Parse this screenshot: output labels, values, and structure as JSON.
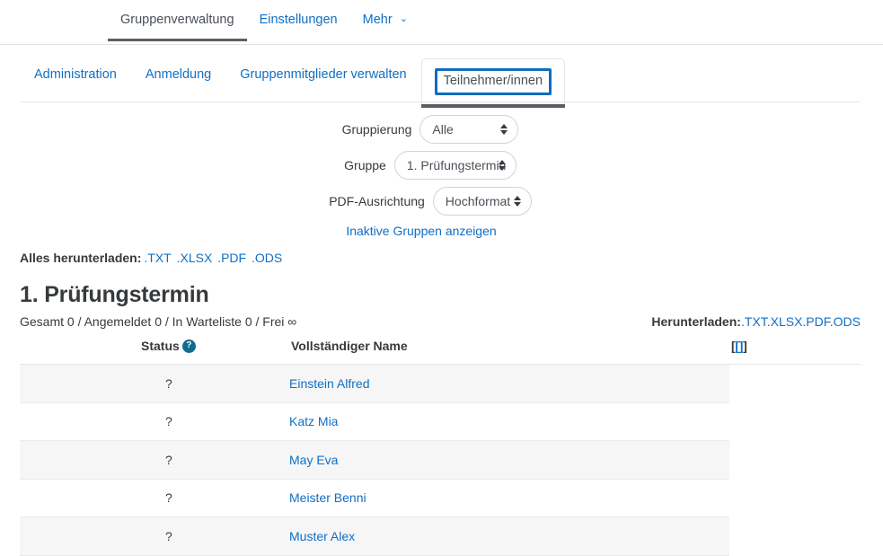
{
  "top_nav": {
    "items": [
      {
        "label": "Gruppenverwaltung",
        "active": true
      },
      {
        "label": "Einstellungen",
        "active": false
      },
      {
        "label": "Mehr",
        "active": false,
        "chevron": "chevron-down-icon"
      }
    ],
    "more_chevron": "⌄"
  },
  "tabs": {
    "items": [
      {
        "label": "Administration",
        "selected": false
      },
      {
        "label": "Anmeldung",
        "selected": false
      },
      {
        "label": "Gruppenmitglieder verwalten",
        "selected": false
      },
      {
        "label": "Teilnehmer/innen",
        "selected": true
      }
    ]
  },
  "filters": {
    "gruppierung": {
      "label": "Gruppierung",
      "value": "Alle"
    },
    "gruppe": {
      "label": "Gruppe",
      "value": "1. Prüfungstermin"
    },
    "pdf_ausrichtung": {
      "label": "PDF-Ausrichtung",
      "value": "Hochformat"
    },
    "inactive_groups_link": "Inaktive Gruppen anzeigen"
  },
  "download_all": {
    "label": "Alles herunterladen:",
    "links": [
      ".TXT",
      ".XLSX",
      ".PDF",
      ".ODS"
    ]
  },
  "group": {
    "title": "1. Prüfungstermin",
    "counts": "Gesamt 0 / Angemeldet 0 / In Warteliste 0 / Frei ∞",
    "download_label": "Herunterladen:",
    "download_links": [
      ".TXT",
      ".XLSX",
      ".PDF",
      ".ODS"
    ]
  },
  "table": {
    "headers": {
      "status": "Status",
      "status_help_icon": "?",
      "name": "Vollständiger Name",
      "extra_prefix": "[",
      "extra_link": "[]",
      "extra_suffix": "]"
    },
    "rows": [
      {
        "status": "?",
        "name": "Einstein Alfred"
      },
      {
        "status": "?",
        "name": "Katz Mia"
      },
      {
        "status": "?",
        "name": "May Eva"
      },
      {
        "status": "?",
        "name": "Meister Benni"
      },
      {
        "status": "?",
        "name": "Muster Alex"
      }
    ]
  },
  "colors": {
    "link": "#0f6fc5",
    "focus_ring": "#0f6cbf",
    "help_icon_bg": "#0f6c8c",
    "active_underline": "#5a5f63",
    "row_stripe": "#f6f6f7",
    "border": "#e4e6e8"
  }
}
